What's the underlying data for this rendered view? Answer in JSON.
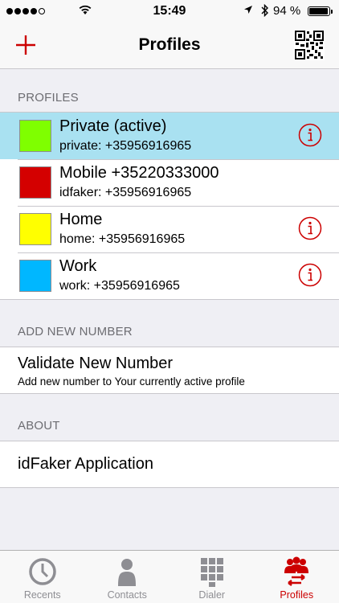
{
  "status_bar": {
    "time": "15:49",
    "battery_text": "94 %",
    "battery_level": 0.94,
    "signal_bars_filled": 4
  },
  "nav": {
    "title": "Profiles",
    "add_icon": "plus-icon",
    "qr_icon": "qr-code-icon",
    "accent_color": "#cc0000"
  },
  "profiles_section": {
    "header": "PROFILES",
    "items": [
      {
        "name": "Private (active)",
        "number": "private: +35956916965",
        "color": "#7fff00",
        "active": true,
        "info": true
      },
      {
        "name": "Mobile +35220333000",
        "number": "idfaker: +35956916965",
        "color": "#d40000",
        "active": false,
        "info": false
      },
      {
        "name": "Home",
        "number": "home: +35956916965",
        "color": "#ffff00",
        "active": false,
        "info": true
      },
      {
        "name": "Work",
        "number": "work: +35956916965",
        "color": "#00b7ff",
        "active": false,
        "info": true
      }
    ]
  },
  "add_section": {
    "header": "ADD NEW NUMBER",
    "title": "Validate New Number",
    "subtitle": "Add new number to Your currently active profile"
  },
  "about_section": {
    "header": "ABOUT",
    "title": "idFaker Application"
  },
  "tabs": [
    {
      "label": "Recents",
      "icon": "clock-icon",
      "selected": false
    },
    {
      "label": "Contacts",
      "icon": "person-icon",
      "selected": false
    },
    {
      "label": "Dialer",
      "icon": "keypad-icon",
      "selected": false
    },
    {
      "label": "Profiles",
      "icon": "profiles-icon",
      "selected": true
    }
  ]
}
